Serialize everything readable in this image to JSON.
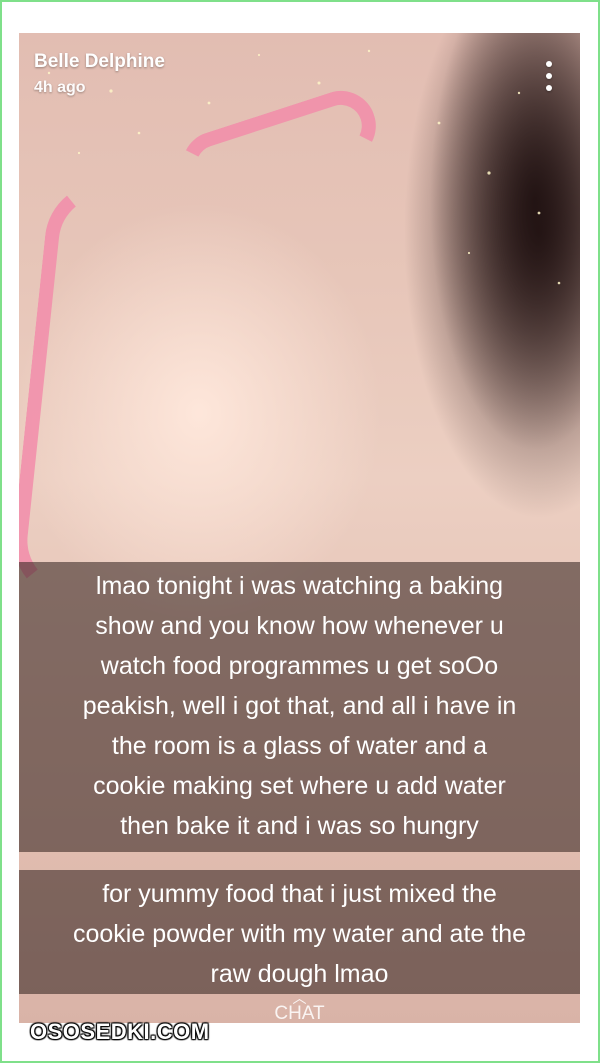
{
  "story": {
    "sender_name": "Belle Delphine",
    "posted_ago": "4h ago",
    "menu_icon": "more-vertical-icon",
    "captions": [
      {
        "lines": [
          "lmao tonight i was watching a baking",
          "show and you know how whenever u",
          "watch food programmes u get soOo",
          "peakish, well i got that, and all i have in",
          "the room is a glass of water and a",
          "cookie making set where u add water",
          "then bake it and i was so hungry"
        ]
      },
      {
        "lines": [
          "for yummy food that i just mixed the",
          "cookie powder with my water and ate the",
          "raw dough lmao"
        ]
      }
    ],
    "chat_label": "CHAT",
    "chat_icon": "chevron-up-icon"
  },
  "watermark": {
    "text": "OSOSEDKI.COM"
  },
  "colors": {
    "frame_border": "#7fe08a",
    "caption_background": "rgba(55,38,34,0.58)",
    "text": "#ffffff"
  }
}
